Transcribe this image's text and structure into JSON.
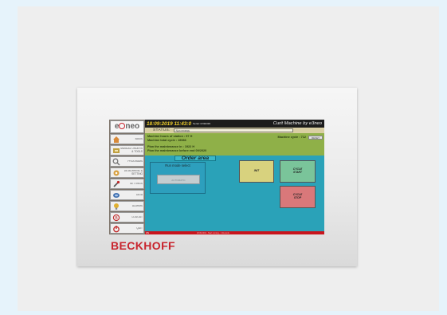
{
  "brand": "BECKHOFF",
  "logo": {
    "text_before": "e",
    "text_after": "neo"
  },
  "header": {
    "datetime": "18:09:2019 11:43:0",
    "serial": "Serial: CN92493",
    "title": "Curit Machine by e3neo"
  },
  "status": {
    "label": "STATUS:",
    "value": "Non emergy"
  },
  "info": {
    "hours": "Machine hours of station : 97 H",
    "total_cycle": "Machine total cycle : 15986",
    "machine_cycle": "Machine cycle : 712",
    "reset_label": "RESET",
    "maint_in": "Plan the maintenance in : 1922 H",
    "maint_before": "Plan the maintenance before end 09/2020"
  },
  "sidebar": {
    "items": [
      {
        "label": "BASIS",
        "icon": "house-icon",
        "color": "#d88a3a"
      },
      {
        "label": "MANUAL ORDERS & TOOLS",
        "icon": "tools-icon",
        "color": "#c0a040"
      },
      {
        "label": "PROGRAMS",
        "icon": "search-icon",
        "color": "#888888"
      },
      {
        "label": "DE-BURRING & SETTING",
        "icon": "wrench-icon",
        "color": "#d8a040"
      },
      {
        "label": "SETTINGS",
        "icon": "settings-icon",
        "color": "#666666"
      },
      {
        "label": "DATA",
        "icon": "data-icon",
        "color": "#4070b0"
      },
      {
        "label": "ALARMS",
        "icon": "bulb-icon",
        "color": "#e0b030"
      },
      {
        "label": "LOGOUT",
        "icon": "logout-icon",
        "color": "#c02828"
      },
      {
        "label": "QUIT",
        "icon": "power-icon",
        "color": "#c02828"
      }
    ]
  },
  "main": {
    "title": "Order area",
    "run_mode": {
      "title": "Run mode select",
      "value": "AUTOMATIC"
    },
    "buttons": {
      "init": "INIT",
      "cycle_start": "CYCLE START",
      "cycle_stop": "CYCLE STOP"
    }
  },
  "footer": {
    "left": "ON",
    "message": "18:09:2019 - Start running - 1 Records"
  },
  "colors": {
    "brand_red": "#c8232c",
    "header_yellow": "#f0cf2a",
    "panel_green": "#8fb048",
    "main_cyan": "#2aa2b8"
  }
}
